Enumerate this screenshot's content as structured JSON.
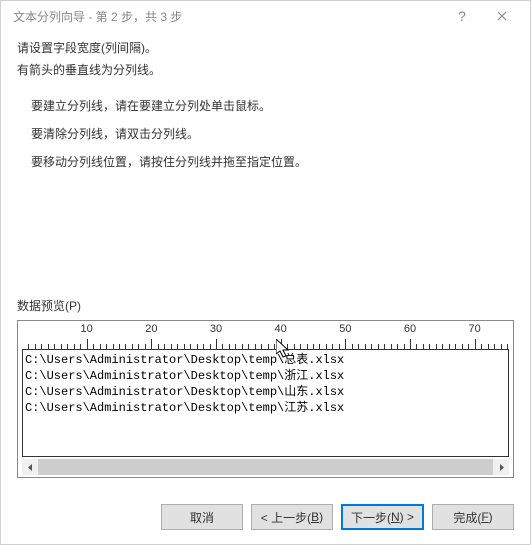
{
  "titlebar": {
    "title": "文本分列向导 - 第 2 步，共 3 步"
  },
  "intro": {
    "line1": "请设置字段宽度(列间隔)。",
    "line2": "有箭头的垂直线为分列线。"
  },
  "instructions": {
    "item1": "要建立分列线，请在要建立分列处单击鼠标。",
    "item2": "要清除分列线，请双击分列线。",
    "item3": "要移动分列线位置，请按住分列线并拖至指定位置。"
  },
  "preview": {
    "label": "数据预览(P)",
    "ruler_ticks": [
      "10",
      "20",
      "30",
      "40",
      "50",
      "60",
      "70"
    ],
    "rows": [
      "C:\\Users\\Administrator\\Desktop\\temp\\总表.xlsx",
      "C:\\Users\\Administrator\\Desktop\\temp\\浙江.xlsx",
      "C:\\Users\\Administrator\\Desktop\\temp\\山东.xlsx",
      "C:\\Users\\Administrator\\Desktop\\temp\\江苏.xlsx"
    ]
  },
  "buttons": {
    "cancel": "取消",
    "back_pre": "< 上一步(",
    "back_key": "B",
    "back_post": ")",
    "next_pre": "下一步(",
    "next_key": "N",
    "next_post": ") >",
    "finish_pre": "完成(",
    "finish_key": "F",
    "finish_post": ")"
  }
}
